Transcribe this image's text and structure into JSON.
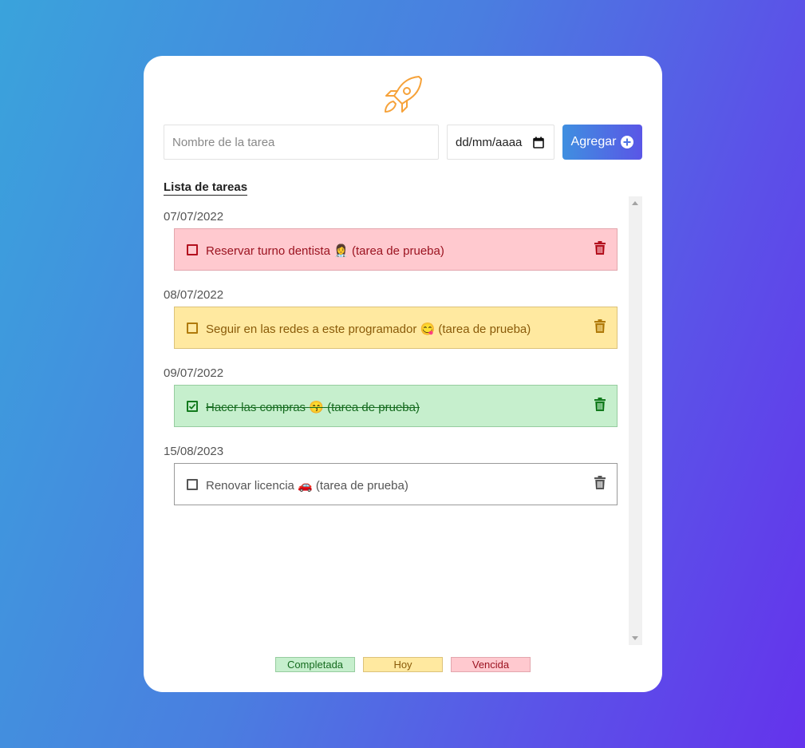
{
  "colors": {
    "overdue_bg": "#ffc9cf",
    "overdue_border": "#e3a6ad",
    "overdue_text": "#9b1320",
    "overdue_icon": "#b3101e",
    "today_bg": "#ffe9a0",
    "today_border": "#dcc27a",
    "today_text": "#8a5b09",
    "today_icon": "#b07a0a",
    "done_bg": "#c6efcd",
    "done_border": "#96cc9f",
    "done_text": "#156b1f",
    "done_icon": "#127a1d",
    "pending_bg": "#ffffff",
    "pending_border": "#9a9a9a",
    "pending_text": "#555555",
    "pending_icon": "#555555",
    "logo": "#f6a23a"
  },
  "header": {
    "logo_icon": "rocket-icon"
  },
  "form": {
    "task_placeholder": "Nombre de la tarea",
    "date_placeholder": "dd/mm/aaaa",
    "date_icon": "calendar-icon",
    "add_label": "Agregar",
    "add_icon": "plus-circle-icon"
  },
  "list": {
    "title": "Lista de tareas",
    "groups": [
      {
        "date": "07/07/2022",
        "task": {
          "label": "Reservar turno dentista",
          "emoji": "👩‍⚕️",
          "suffix": "(tarea de prueba)",
          "status": "overdue",
          "checked": false
        }
      },
      {
        "date": "08/07/2022",
        "task": {
          "label": "Seguir en las redes a este programador",
          "emoji": "😋",
          "suffix": "(tarea de prueba)",
          "status": "today",
          "checked": false
        }
      },
      {
        "date": "09/07/2022",
        "task": {
          "label": "Hacer las compras",
          "emoji": "😙",
          "suffix": "(tarea de prueba)",
          "status": "done",
          "checked": true
        }
      },
      {
        "date": "15/08/2023",
        "task": {
          "label": "Renovar licencia",
          "emoji": "🚗",
          "suffix": "(tarea de prueba)",
          "status": "pending",
          "checked": false
        }
      }
    ]
  },
  "legend": {
    "done": "Completada",
    "today": "Hoy",
    "overdue": "Vencida"
  }
}
